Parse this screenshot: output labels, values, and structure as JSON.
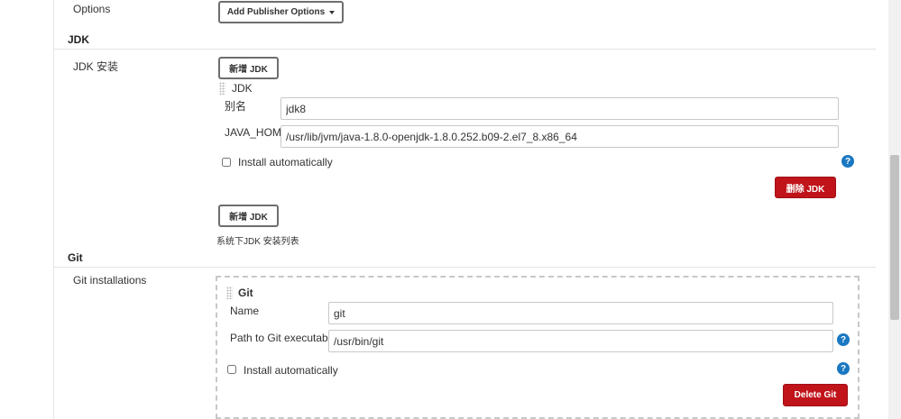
{
  "publisher": {
    "label": "Options",
    "button_label": "Add Publisher Options"
  },
  "jdk": {
    "section_title": "JDK",
    "row_label": "JDK 安装",
    "add_button": "新增 JDK",
    "item_title": "JDK",
    "alias_label": "别名",
    "alias_value": "jdk8",
    "java_home_label": "JAVA_HOME",
    "java_home_value": "/usr/lib/jvm/java-1.8.0-openjdk-1.8.0.252.b09-2.el7_8.x86_64",
    "install_auto_label": "Install automatically",
    "delete_button": "删除 JDK",
    "add_button_bottom": "新增 JDK",
    "list_caption": "系统下JDK 安装列表"
  },
  "git": {
    "section_title": "Git",
    "row_label": "Git installations",
    "item_title": "Git",
    "name_label": "Name",
    "name_value": "git",
    "path_label": "Path to Git executable",
    "path_value": "/usr/bin/git",
    "install_auto_label": "Install automatically",
    "delete_button": "Delete Git"
  },
  "icons": {
    "help": "?",
    "dropdown": "caret-down-icon",
    "drag": "drag-handle-icon"
  },
  "colors": {
    "accent_red": "#c0141a",
    "help_blue": "#1a78c2"
  }
}
